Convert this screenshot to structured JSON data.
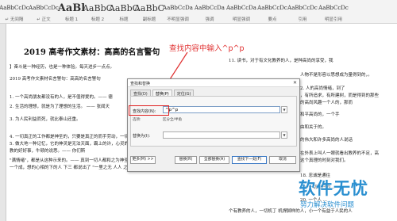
{
  "ribbon": {
    "styles": [
      {
        "sample": "AaBbCcDc",
        "name": "↵ 无间隔",
        "size": "small"
      },
      {
        "sample": "AaBbCcDc",
        "name": "↵ 正文",
        "size": "small"
      },
      {
        "sample": "AaBl",
        "name": "标题 1",
        "size": "big"
      },
      {
        "sample": "AaBbC",
        "name": "标题 2",
        "size": "mid"
      },
      {
        "sample": "AaBbC",
        "name": "标题",
        "size": "mid"
      },
      {
        "sample": "AaBbC",
        "name": "副标题",
        "size": "mid"
      },
      {
        "sample": "AaBbCcDa",
        "name": "不明显强调",
        "size": "small"
      },
      {
        "sample": "AaBbCcDa",
        "name": "强调",
        "size": "small"
      },
      {
        "sample": "AaBbCcDa",
        "name": "明显强调",
        "size": "small"
      },
      {
        "sample": "AaBbCcDc",
        "name": "要点",
        "size": "small"
      },
      {
        "sample": "AaBbCcDc",
        "name": "引用",
        "size": "small"
      },
      {
        "sample": "AaBbCcDc",
        "name": "明显引用",
        "size": "small"
      }
    ]
  },
  "document": {
    "title": "2019 高考作文素材：高高的名言警句",
    "left_lines": [
      "】奋斗是一种经历，也是一种体验。每天进步一点点。",
      "2019 高考作文素材名言警句：高高的名言警句",
      "1. 一个高尚朋友都没有的人，是不值得爱的。—— 德",
      "2. 生活的理想，就是为了理想的生活。 —— 张闻天",
      "3. 为人民利益而死，就比泰山还重。",
      "4. 一切真正的工作都是神圣的，只要是真正的而手劳动，一切的工作都有几分神圣性。",
      "5. 做大地一种记忆，它的神灵是无法天面，霸上的许，心灵的许：几是",
      "教的好好事，牛顿的说思。—— 你们斯",
      "\"满情绪\"，都是从这种示来的。—— 真到一切人都和之为神圣的那种\"高洋的真",
      "一个成，想的心相的下的人 下三 都说出了 \"一里之无 人人 之外在 了 高不可"
    ],
    "right_lines": [
      "11. 读书，对于有文化教养的人，是种高尚的享受，我",
      "人物不是形容以思想成为量得到的，。",
      "2. 人的高尚情绪，到了",
      "，有所追求，有所建树，而是得到的那些",
      "的高尚风趣一个人的，那而",
      "和平高尚的，一个手",
      "由和关于的。",
      "的伟大和许多高尚的人说话",
      "在外表上叫人一眼就看出教养的不足，高",
      "这个真理的时刻对我们。",
      "18. 忠诚是通往",
      "19. 一切利己的...",
      "20. 一个人 ...",
      "个有教养的人，一切机丁 机焊脚样的人，小一个有益于人民的人"
    ]
  },
  "dialog": {
    "title": "查找和替换",
    "close_glyph": "✕",
    "tabs": [
      "查找(D)",
      "替换(P)",
      "定位(G)"
    ],
    "active_tab": 1,
    "find_label": "查找内容(N):",
    "find_value": "^p^p",
    "options_label": "选项:",
    "options_value": "区分全/半角",
    "replace_label": "替换为(I):",
    "replace_value": "",
    "dropdown_glyph": "▼",
    "buttons": {
      "more": "更多(M) >>",
      "replace": "替换(R)",
      "replace_all": "全部替换(A)",
      "find_next": "查找下一处(F)",
      "cancel": "取消"
    }
  },
  "annotation": {
    "text": "查找内容中输入^p^p",
    "color": "#e03030"
  },
  "watermark": {
    "main": "软件无忧",
    "sub": "努力解决软件问题"
  },
  "colors": {
    "highlight": "#e02020",
    "watermark": "#2a8fd0"
  }
}
